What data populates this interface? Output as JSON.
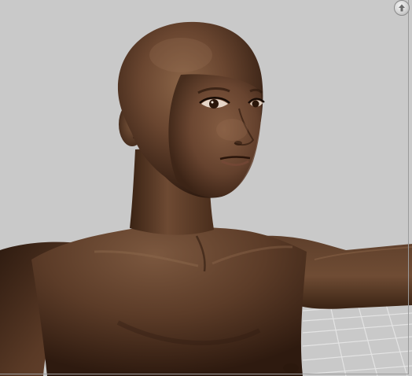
{
  "viewport": {
    "background_color": "#c9c9c9",
    "grid_color": "#e2e2e2",
    "skin_color": "#5b3b25"
  },
  "nav_button": {
    "icon": "arrow-up-icon"
  }
}
